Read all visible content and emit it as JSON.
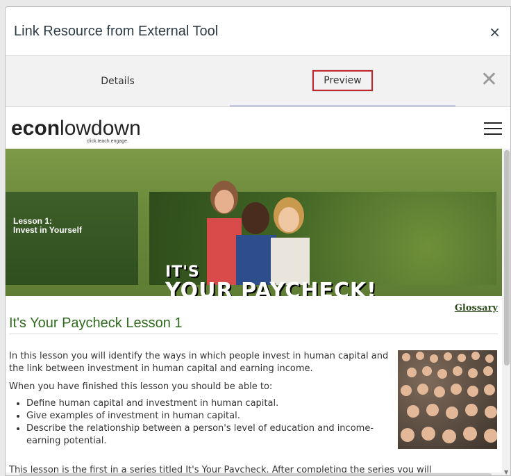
{
  "dialog": {
    "title": "Link Resource from External Tool",
    "close_glyph": "×"
  },
  "tabs": [
    {
      "label": "Details",
      "active": false
    },
    {
      "label": "Preview",
      "active": true
    }
  ],
  "tabbar_close_glyph": "✕",
  "site": {
    "logo_bold": "econ",
    "logo_light": "lowdown",
    "logo_tagline": "click.teach.engage."
  },
  "banner": {
    "lesson_label": "Lesson 1:",
    "lesson_subtitle": "Invest in Yourself",
    "title_line1": "IT'S",
    "title_line2": "YOUR PAYCHECK!"
  },
  "content": {
    "glossary_link": "Glossary",
    "heading": "It's Your Paycheck Lesson 1",
    "paragraph1": "In this lesson you will identify the ways in which people invest in human capital and the link between investment in human capital and earning income.",
    "paragraph2": "When you have finished this lesson you should be able to:",
    "bullets": [
      "Define human capital and investment in human capital.",
      "Give examples of investment in human capital.",
      "Describe the relationship between a person's level of education and income-earning potential."
    ],
    "cut_off_line": "This lesson is the first in a series titled It's Your Paycheck. After completing the series you will"
  },
  "colors": {
    "accent_green": "#2e6b1d",
    "banner_green": "#6b8a3b",
    "highlight_red": "#c0272d"
  }
}
